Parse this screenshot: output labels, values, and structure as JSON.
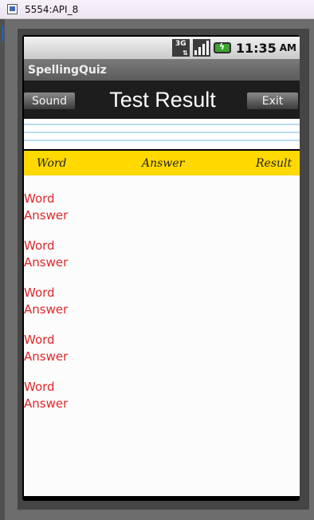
{
  "window": {
    "title": "5554:API_8"
  },
  "status_bar": {
    "network": "3G",
    "time": "11:35",
    "ampm": "AM"
  },
  "app": {
    "title": "SpellingQuiz"
  },
  "header": {
    "sound_label": "Sound",
    "title": "Test Result",
    "exit_label": "Exit"
  },
  "columns": {
    "word": "Word",
    "answer": "Answer",
    "result": "Result"
  },
  "results": [
    {
      "word": "Word",
      "answer": "Answer"
    },
    {
      "word": "Word",
      "answer": "Answer"
    },
    {
      "word": "Word",
      "answer": "Answer"
    },
    {
      "word": "Word",
      "answer": "Answer"
    },
    {
      "word": "Word",
      "answer": "Answer"
    }
  ],
  "colors": {
    "header_yellow": "#ffd900",
    "result_text": "#e0262a",
    "battery": "#3aa52d"
  }
}
